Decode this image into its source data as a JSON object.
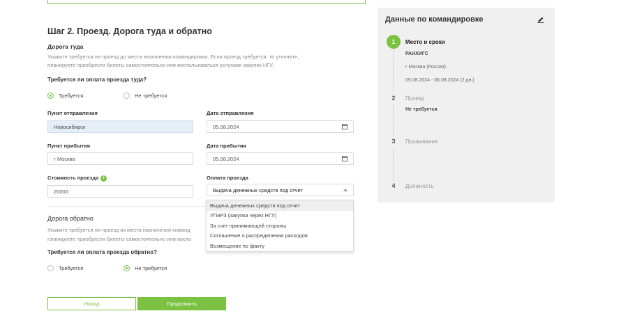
{
  "section": {
    "title": "Шаг 2. Проезд. Дорога туда и обратно",
    "outbound": {
      "heading": "Дорога туда",
      "desc_line1": "Укажите требуется ли проезд до места назначения командировки. Если проезд требуется, то уточните,",
      "desc_line2": "планируете приобрести билеты самостоятельно или воспользоваться услугами закупок НГУ.",
      "question": "Требуется ли оплата проезда туда?",
      "opt_required": "Требуется",
      "opt_not_required": "Не требуется",
      "selected": "Требуется"
    },
    "fields": {
      "departure_point_label": "Пункт отправления",
      "departure_point_value": "Новосибирск",
      "departure_date_label": "Дата отправления",
      "departure_date_value": "05.08.2024",
      "arrival_point_label": "Пункт прибытия",
      "arrival_point_value": "г Москва",
      "arrival_date_label": "Дата прибытия",
      "arrival_date_value": "05.08.2024",
      "cost_label": "Стоимость проезда",
      "cost_value": "20000",
      "payment_label": "Оплата проезда",
      "payment_value": "Выдача денежных средств под отчет"
    },
    "payment_options": [
      "Выдача денежных средств под отчет",
      "УПиРЗ (закупка через НГУ)",
      "За счет принимающей стороны",
      "Соглашение о распределении расходов",
      "Возмещение по факту"
    ],
    "return": {
      "heading": "Дорога обратно",
      "desc_line1": "Укажите требуется ли проезд из места назначения команд",
      "desc_line2": "планируете приобрести билеты самостоятельно или воспо",
      "question": "Требуется ли оплата проезда обратно?",
      "opt_required": "Требуется",
      "opt_not_required": "Не требуется",
      "selected": "Не требуется"
    }
  },
  "buttons": {
    "back": "Назад",
    "next": "Продолжить"
  },
  "panel": {
    "title": "Данные по командировке",
    "edit_icon": "pencil-icon",
    "steps": [
      {
        "num": "1",
        "title": "Место и сроки",
        "details": [
          "РАНХИГС",
          "г Москва (Россия)",
          "05.08.2024 - 06.08.2024 (2 дн.)"
        ]
      },
      {
        "num": "2",
        "title": "Проезд",
        "details": [
          "Не требуется"
        ]
      },
      {
        "num": "3",
        "title": "Проживание",
        "details": []
      },
      {
        "num": "4",
        "title": "Должность",
        "details": []
      }
    ]
  },
  "colors": {
    "accent": "#7cc242",
    "panel_bg": "#f0f0f0",
    "filled_input_bg": "#e6eef8"
  }
}
